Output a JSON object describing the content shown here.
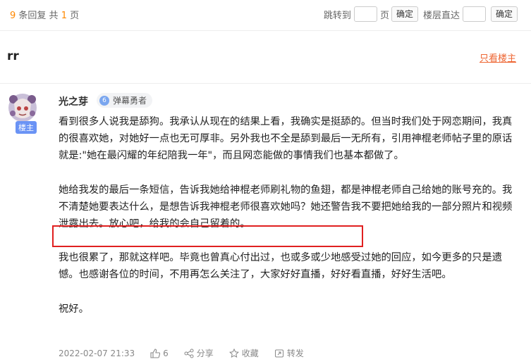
{
  "pager": {
    "count": "9",
    "replies_label": "条回复 共",
    "pages": "1",
    "pages_suffix": "页",
    "jump_label": "跳转到",
    "page_unit": "页",
    "confirm1": "确定",
    "floor_label": "楼层直达",
    "confirm2": "确定"
  },
  "thread": {
    "title": "rr",
    "only_op": "只看楼主"
  },
  "post": {
    "username": "光之芽",
    "badge_level": "6",
    "badge_text": "弹幕勇者",
    "op_tag": "楼主",
    "paragraphs": [
      "看到很多人说我是舔狗。我承认从现在的结果上看，我确实是挺舔的。但当时我们处于网恋期间，我真的很喜欢她，对她好一点也无可厚非。另外我也不全是舔到最后一无所有，引用神棍老师帖子里的原话就是:\"她在最闪耀的年纪陪我一年\"，而且网恋能做的事情我们也基本都做了。",
      "她给我发的最后一条短信，告诉我她给神棍老师刷礼物的鱼翅，都是神棍老师自己给她的账号充的。我不清楚她要表达什么，是想告诉我神棍老师很喜欢她吗？她还警告我不要把她给我的一部分照片和视频泄露出去。放心吧，给我的会自己留着的。",
      "我也很累了，那就这样吧。毕竟也曾真心付出过，也或多或少地感受过她的回应，如今更多的只是遗憾。也感谢各位的时间，不用再怎么关注了，大家好好直播，好好看直播，好好生活吧。",
      "祝好。"
    ],
    "timestamp": "2022-02-07 21:33",
    "likes": "6",
    "share": "分享",
    "favorite": "收藏",
    "forward": "转发"
  }
}
